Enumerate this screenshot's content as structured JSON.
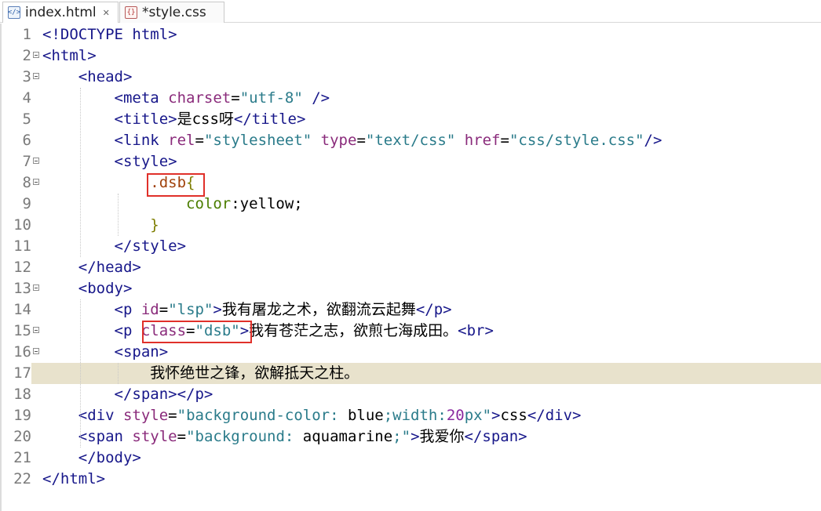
{
  "tabs": [
    {
      "label": "index.html",
      "icon": "html-file-icon",
      "active": true,
      "close": "✕"
    },
    {
      "label": "*style.css",
      "icon": "css-file-icon",
      "active": false
    }
  ],
  "colors": {
    "current_line": "#e8e2cc",
    "highlight_box": "#e0302a"
  },
  "current_line": 17,
  "lines": [
    {
      "n": "1",
      "parts": [
        {
          "c": "tag",
          "t": "<!DOCTYPE html>"
        }
      ]
    },
    {
      "n": "2",
      "fold": true,
      "parts": [
        {
          "c": "tag",
          "t": "<html>"
        }
      ]
    },
    {
      "n": "3",
      "fold": true,
      "parts": [
        {
          "c": "txt",
          "t": "    "
        },
        {
          "c": "tag",
          "t": "<head>"
        }
      ]
    },
    {
      "n": "4",
      "parts": [
        {
          "c": "txt",
          "t": "        "
        },
        {
          "c": "tag",
          "t": "<meta "
        },
        {
          "c": "attr",
          "t": "charset"
        },
        {
          "c": "txt",
          "t": "="
        },
        {
          "c": "val",
          "t": "\"utf-8\""
        },
        {
          "c": "tag",
          "t": " />"
        }
      ]
    },
    {
      "n": "5",
      "parts": [
        {
          "c": "txt",
          "t": "        "
        },
        {
          "c": "tag",
          "t": "<title>"
        },
        {
          "c": "txt",
          "t": "是css呀"
        },
        {
          "c": "tag",
          "t": "</title>"
        }
      ]
    },
    {
      "n": "6",
      "parts": [
        {
          "c": "txt",
          "t": "        "
        },
        {
          "c": "tag",
          "t": "<link "
        },
        {
          "c": "attr",
          "t": "rel"
        },
        {
          "c": "txt",
          "t": "="
        },
        {
          "c": "val",
          "t": "\"stylesheet\""
        },
        {
          "c": "txt",
          "t": " "
        },
        {
          "c": "attr",
          "t": "type"
        },
        {
          "c": "txt",
          "t": "="
        },
        {
          "c": "val",
          "t": "\"text/css\""
        },
        {
          "c": "txt",
          "t": " "
        },
        {
          "c": "attr",
          "t": "href"
        },
        {
          "c": "txt",
          "t": "="
        },
        {
          "c": "val",
          "t": "\"css/style.css\""
        },
        {
          "c": "tag",
          "t": "/>"
        }
      ]
    },
    {
      "n": "7",
      "fold": true,
      "parts": [
        {
          "c": "txt",
          "t": "        "
        },
        {
          "c": "tag",
          "t": "<style>"
        }
      ]
    },
    {
      "n": "8",
      "fold": true,
      "parts": [
        {
          "c": "txt",
          "t": "            "
        },
        {
          "c": "sel",
          "t": ".dsb"
        },
        {
          "c": "brace",
          "t": "{"
        }
      ]
    },
    {
      "n": "9",
      "parts": [
        {
          "c": "txt",
          "t": "                "
        },
        {
          "c": "prop",
          "t": "color"
        },
        {
          "c": "txt",
          "t": ":yellow;"
        }
      ]
    },
    {
      "n": "10",
      "parts": [
        {
          "c": "txt",
          "t": "            "
        },
        {
          "c": "brace",
          "t": "}"
        }
      ]
    },
    {
      "n": "11",
      "parts": [
        {
          "c": "txt",
          "t": "        "
        },
        {
          "c": "tag",
          "t": "</style>"
        }
      ]
    },
    {
      "n": "12",
      "parts": [
        {
          "c": "txt",
          "t": "    "
        },
        {
          "c": "tag",
          "t": "</head>"
        }
      ]
    },
    {
      "n": "13",
      "fold": true,
      "parts": [
        {
          "c": "txt",
          "t": "    "
        },
        {
          "c": "tag",
          "t": "<body>"
        }
      ]
    },
    {
      "n": "14",
      "parts": [
        {
          "c": "txt",
          "t": "        "
        },
        {
          "c": "tag",
          "t": "<p "
        },
        {
          "c": "attr",
          "t": "id"
        },
        {
          "c": "txt",
          "t": "="
        },
        {
          "c": "val",
          "t": "\"lsp\""
        },
        {
          "c": "tag",
          "t": ">"
        },
        {
          "c": "txt",
          "t": "我有屠龙之术，欲翻流云起舞"
        },
        {
          "c": "tag",
          "t": "</p>"
        }
      ]
    },
    {
      "n": "15",
      "fold": true,
      "parts": [
        {
          "c": "txt",
          "t": "        "
        },
        {
          "c": "tag",
          "t": "<p "
        },
        {
          "c": "attr",
          "t": "class"
        },
        {
          "c": "txt",
          "t": "="
        },
        {
          "c": "val",
          "t": "\"dsb\""
        },
        {
          "c": "tag",
          "t": ">"
        },
        {
          "c": "txt",
          "t": "我有苍茫之志，欲煎七海成田。"
        },
        {
          "c": "tag",
          "t": "<br>"
        }
      ]
    },
    {
      "n": "16",
      "fold": true,
      "parts": [
        {
          "c": "txt",
          "t": "        "
        },
        {
          "c": "tag",
          "t": "<span>"
        }
      ]
    },
    {
      "n": "17",
      "parts": [
        {
          "c": "txt",
          "t": "            我怀绝世之锋，欲解抵天之柱。"
        }
      ]
    },
    {
      "n": "18",
      "parts": [
        {
          "c": "txt",
          "t": "        "
        },
        {
          "c": "tag",
          "t": "</span></p>"
        }
      ]
    },
    {
      "n": "19",
      "parts": [
        {
          "c": "txt",
          "t": "    "
        },
        {
          "c": "tag",
          "t": "<div "
        },
        {
          "c": "attr",
          "t": "style"
        },
        {
          "c": "txt",
          "t": "="
        },
        {
          "c": "val",
          "t": "\"background-color: "
        },
        {
          "c": "txt",
          "t": "blue"
        },
        {
          "c": "val",
          "t": ";width:"
        },
        {
          "c": "num",
          "t": "20"
        },
        {
          "c": "val",
          "t": "px\""
        },
        {
          "c": "tag",
          "t": ">"
        },
        {
          "c": "txt",
          "t": "css"
        },
        {
          "c": "tag",
          "t": "</div>"
        }
      ]
    },
    {
      "n": "20",
      "parts": [
        {
          "c": "txt",
          "t": "    "
        },
        {
          "c": "tag",
          "t": "<span "
        },
        {
          "c": "attr",
          "t": "style"
        },
        {
          "c": "txt",
          "t": "="
        },
        {
          "c": "val",
          "t": "\"background: "
        },
        {
          "c": "txt",
          "t": "aquamarine"
        },
        {
          "c": "val",
          "t": ";\""
        },
        {
          "c": "tag",
          "t": ">"
        },
        {
          "c": "txt",
          "t": "我爱你"
        },
        {
          "c": "tag",
          "t": "</span>"
        }
      ]
    },
    {
      "n": "21",
      "parts": [
        {
          "c": "txt",
          "t": "    "
        },
        {
          "c": "tag",
          "t": "</body>"
        }
      ]
    },
    {
      "n": "22",
      "parts": [
        {
          "c": "tag",
          "t": "</html>"
        }
      ]
    }
  ]
}
